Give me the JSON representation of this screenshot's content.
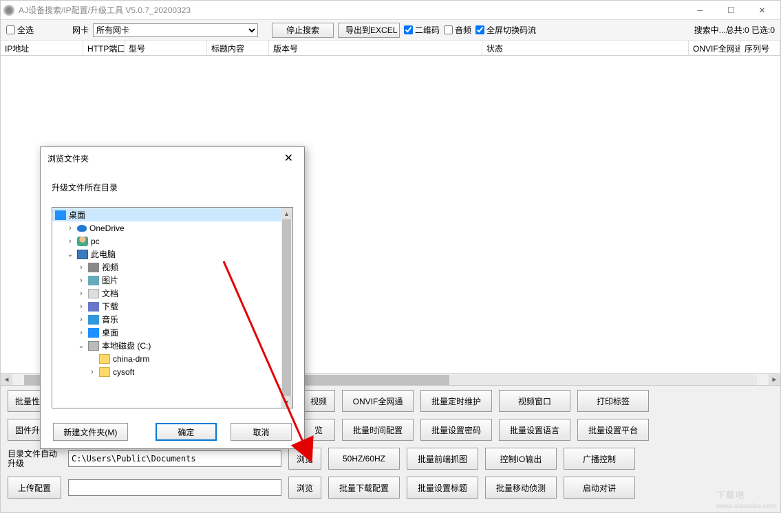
{
  "window": {
    "title": "AJ设备搜索/IP配置/升级工具 V5.0.7_20200323"
  },
  "toolbar": {
    "select_all": "全选",
    "nic_label": "网卡",
    "nic_value": "所有网卡",
    "stop_search": "停止搜索",
    "export_excel": "导出到EXCEL",
    "qrcode": "二维码",
    "audio": "音频",
    "fullscreen_switch": "全屏切换码流",
    "status": "搜索中...总共:0 已选:0"
  },
  "columns": {
    "ip": "IP地址",
    "http_port": "HTTP端口",
    "model": "型号",
    "title_content": "标题内容",
    "version": "版本号",
    "state": "状态",
    "onvif": "ONVIF全网通",
    "serial": "序列号"
  },
  "buttons": {
    "row1": [
      "批量性",
      "",
      "",
      "视频",
      "ONVIF全网通",
      "批量定时维护",
      "视频窗口",
      "打印标签"
    ],
    "row2": [
      "固件升",
      "",
      "",
      "览",
      "批量时间配置",
      "批量设置密码",
      "批量设置语言",
      "批量设置平台"
    ],
    "row3_label": "目录文件自动升级",
    "row3_path": "C:\\Users\\Public\\Documents",
    "row3_browse": "浏览",
    "row3": [
      "50HZ/60HZ",
      "批量前端抓图",
      "控制IO输出",
      "广播控制"
    ],
    "row4_upload": "上传配置",
    "row4_browse": "浏览",
    "row4": [
      "批量下载配置",
      "批量设置标题",
      "批量移动侦测",
      "启动对讲"
    ]
  },
  "dialog": {
    "title": "浏览文件夹",
    "prompt": "升级文件所在目录",
    "new_folder": "新建文件夹(M)",
    "ok": "确定",
    "cancel": "取消",
    "tree": {
      "desktop": "桌面",
      "onedrive": "OneDrive",
      "pc_user": "pc",
      "this_pc": "此电脑",
      "video": "视频",
      "pictures": "图片",
      "documents": "文档",
      "downloads": "下载",
      "music": "音乐",
      "desktop2": "桌面",
      "disk_c": "本地磁盘 (C:)",
      "china_drm": "china-drm",
      "cysoft": "cysoft"
    }
  },
  "watermark": {
    "main": "下载吧",
    "sub": "www.xiazaiba.com"
  }
}
